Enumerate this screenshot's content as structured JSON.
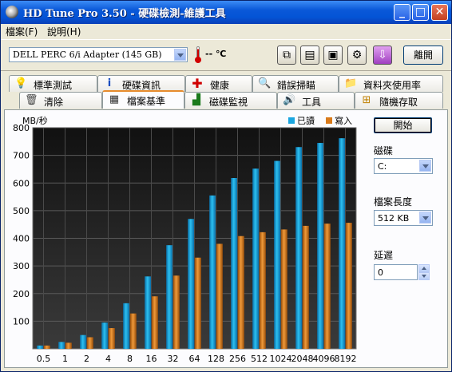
{
  "window": {
    "title": "HD Tune Pro 3.50 - 硬碟檢測-維護工具"
  },
  "menu": [
    {
      "label": "檔案(F)"
    },
    {
      "label": "說明(H)"
    }
  ],
  "toolbar": {
    "drive": "DELL    PERC 6/i Adapter (145 GB)",
    "temperature": "-- ℃",
    "exit_label": "離開"
  },
  "tabs_top": [
    {
      "label": "標準測試",
      "icon": "lightbulb-icon"
    },
    {
      "label": "硬碟資訊",
      "icon": "info-icon"
    },
    {
      "label": "健康",
      "icon": "red-cross-icon"
    },
    {
      "label": "錯誤掃瞄",
      "icon": "magnifier-icon"
    },
    {
      "label": "資料夾使用率",
      "icon": "folder-icon"
    }
  ],
  "tabs_bottom": [
    {
      "label": "清除",
      "icon": "trash-icon"
    },
    {
      "label": "檔案基準",
      "icon": "document-icon",
      "active": true
    },
    {
      "label": "磁碟監視",
      "icon": "bar-chart-icon"
    },
    {
      "label": "工具",
      "icon": "speaker-icon"
    },
    {
      "label": "隨機存取",
      "icon": "random-access-icon"
    }
  ],
  "side": {
    "start_label": "開始",
    "disk_label": "磁碟",
    "disk_value": "C:",
    "file_length_label": "檔案長度",
    "file_length_value": "512 KB",
    "delay_label": "延遲",
    "delay_value": "0"
  },
  "chart_data": {
    "type": "bar",
    "ylabel": "MB/秒",
    "ylim": [
      0,
      800
    ],
    "yticks": [
      100,
      200,
      300,
      400,
      500,
      600,
      700,
      800
    ],
    "categories": [
      "0.5",
      "1",
      "2",
      "4",
      "8",
      "16",
      "32",
      "64",
      "128",
      "256",
      "512",
      "1024",
      "2048",
      "4096",
      "8192"
    ],
    "series": [
      {
        "name": "已讀",
        "color": "#1aa6e0",
        "values": [
          12,
          25,
          50,
          95,
          165,
          262,
          375,
          470,
          555,
          618,
          652,
          680,
          730,
          745,
          762
        ]
      },
      {
        "name": "寫入",
        "color": "#d97a1a",
        "values": [
          12,
          22,
          42,
          75,
          128,
          190,
          265,
          330,
          380,
          408,
          422,
          432,
          445,
          453,
          456
        ]
      }
    ],
    "grid": true,
    "legend": "top-right"
  },
  "colors": {
    "titlebar": "#0a58d8",
    "panel_bg": "#fcfcfe",
    "plot_bg": "#1a1a1a"
  }
}
